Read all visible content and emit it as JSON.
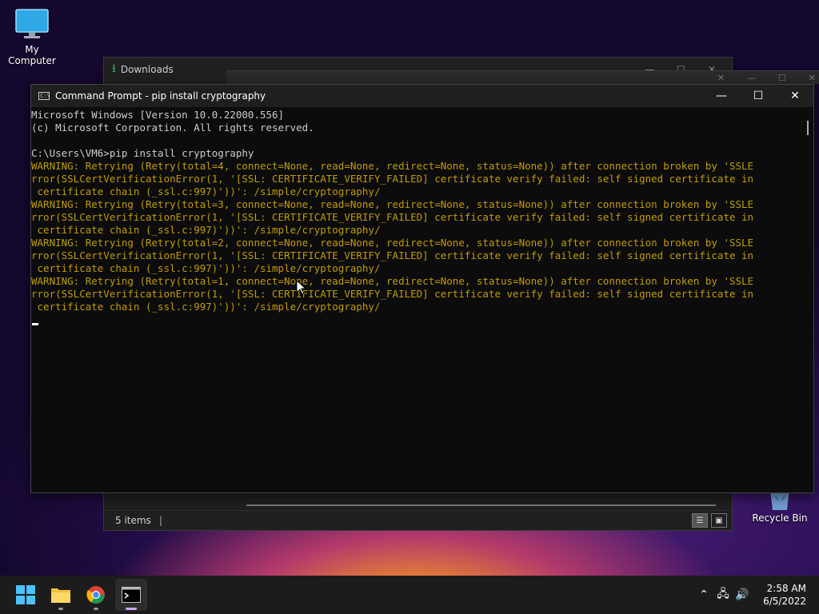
{
  "desktop": {
    "my_computer": "My Computer",
    "recycle_bin": "Recycle Bin"
  },
  "explorer": {
    "title": "Downloads",
    "status_items": "5 items"
  },
  "cmd": {
    "title": "Command Prompt - pip  install cryptography",
    "lines": [
      {
        "text": "Microsoft Windows [Version 10.0.22000.556]",
        "warn": false
      },
      {
        "text": "(c) Microsoft Corporation. All rights reserved.",
        "warn": false
      },
      {
        "text": "",
        "warn": false
      },
      {
        "text": "C:\\Users\\VM6>pip install cryptography",
        "warn": false
      },
      {
        "text": "WARNING: Retrying (Retry(total=4, connect=None, read=None, redirect=None, status=None)) after connection broken by 'SSLE",
        "warn": true
      },
      {
        "text": "rror(SSLCertVerificationError(1, '[SSL: CERTIFICATE_VERIFY_FAILED] certificate verify failed: self signed certificate in",
        "warn": true
      },
      {
        "text": " certificate chain (_ssl.c:997)'))': /simple/cryptography/",
        "warn": true
      },
      {
        "text": "WARNING: Retrying (Retry(total=3, connect=None, read=None, redirect=None, status=None)) after connection broken by 'SSLE",
        "warn": true
      },
      {
        "text": "rror(SSLCertVerificationError(1, '[SSL: CERTIFICATE_VERIFY_FAILED] certificate verify failed: self signed certificate in",
        "warn": true
      },
      {
        "text": " certificate chain (_ssl.c:997)'))': /simple/cryptography/",
        "warn": true
      },
      {
        "text": "WARNING: Retrying (Retry(total=2, connect=None, read=None, redirect=None, status=None)) after connection broken by 'SSLE",
        "warn": true
      },
      {
        "text": "rror(SSLCertVerificationError(1, '[SSL: CERTIFICATE_VERIFY_FAILED] certificate verify failed: self signed certificate in",
        "warn": true
      },
      {
        "text": " certificate chain (_ssl.c:997)'))': /simple/cryptography/",
        "warn": true
      },
      {
        "text": "WARNING: Retrying (Retry(total=1, connect=None, read=None, redirect=None, status=None)) after connection broken by 'SSLE",
        "warn": true
      },
      {
        "text": "rror(SSLCertVerificationError(1, '[SSL: CERTIFICATE_VERIFY_FAILED] certificate verify failed: self signed certificate in",
        "warn": true
      },
      {
        "text": " certificate chain (_ssl.c:997)'))': /simple/cryptography/",
        "warn": true
      }
    ]
  },
  "taskbar": {
    "apps": [
      "start-icon",
      "file-explorer-icon",
      "chrome-icon",
      "terminal-icon"
    ],
    "time": "2:58 AM",
    "date": "6/5/2022"
  },
  "colors": {
    "warning": "#c19c00",
    "console_text": "#cccccc",
    "console_bg": "#0c0c0c"
  }
}
